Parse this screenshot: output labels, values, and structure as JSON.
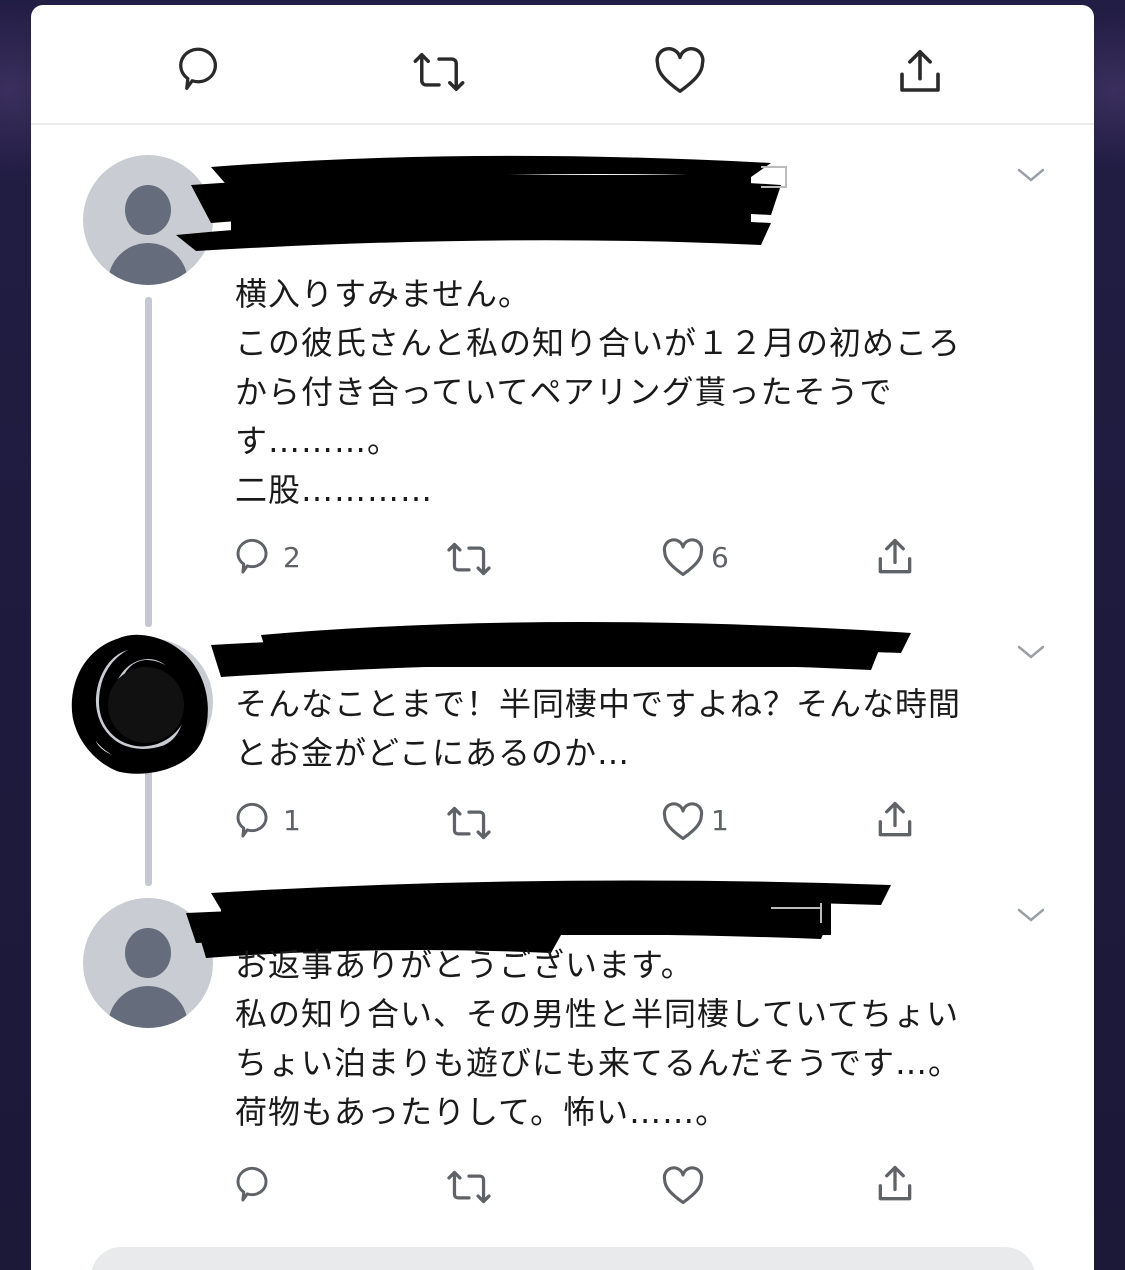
{
  "toolbar": {
    "icons": [
      "reply-icon",
      "retweet-icon",
      "like-icon",
      "share-icon"
    ]
  },
  "tweets": [
    {
      "author_redacted": true,
      "lines": [
        "横入りすみません。",
        "この彼氏さんと私の知り合いが１２月の初めころ",
        "から付き合っていてペアリング貰ったそうで",
        "す………。",
        "二股…………"
      ],
      "reply_count": "2",
      "retweet_count": "",
      "like_count": "6"
    },
    {
      "author_redacted": true,
      "lines": [
        "そんなことまで！半同棲中ですよね？そんな時間",
        "とお金がどこにあるのか…"
      ],
      "reply_count": "1",
      "retweet_count": "",
      "like_count": "1"
    },
    {
      "author_redacted": true,
      "lines": [
        "お返事ありがとうございます。",
        "私の知り合い、その男性と半同棲していてちょい",
        "ちょい泊まりも遊びにも来てるんだそうです…。",
        "荷物もあったりして。怖い……。"
      ],
      "reply_count": "",
      "retweet_count": "",
      "like_count": ""
    }
  ],
  "colors": {
    "background": "#1e1b3c",
    "card": "#ffffff",
    "icon": "#5f6368",
    "text": "#1a1a1a",
    "redaction": "#000000"
  }
}
